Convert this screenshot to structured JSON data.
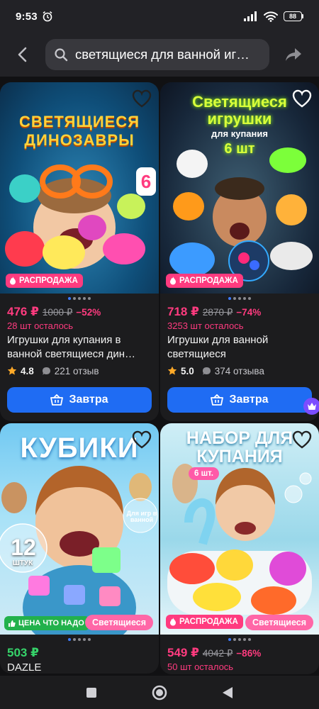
{
  "status_bar": {
    "time": "9:53",
    "battery": "88"
  },
  "header": {
    "search_query": "светящиеся для ванной иг…"
  },
  "products": [
    {
      "image_title_1": "СВЕТЯЩИЕСЯ",
      "image_title_2": "ДИНОЗАВРЫ",
      "image_count": "6",
      "badge": "РАСПРОДАЖА",
      "price": "476 ₽",
      "old_price": "1000 ₽",
      "discount": "−52%",
      "stock": "28 шт осталось",
      "title": "Игрушки для купания в ванной светящиеся дин…",
      "rating": "4.8",
      "reviews": "221 отзыв",
      "button": "Завтра"
    },
    {
      "image_title_1": "Светящиеся",
      "image_title_2": "игрушки",
      "image_title_3": "для купания",
      "image_count": "6 шт",
      "badge": "РАСПРОДАЖА",
      "price": "718 ₽",
      "old_price": "2870 ₽",
      "discount": "−74%",
      "stock": "3253 шт осталось",
      "title": "Игрушки для ванной светящиеся",
      "rating": "5.0",
      "reviews": "374 отзыва",
      "button": "Завтра"
    },
    {
      "image_title_1": "КУБИКИ",
      "image_count": "12",
      "image_count_unit": "ШТУК",
      "image_side_note": "Для игр в ванной",
      "badge": "ЦЕНА ЧТО НАДО",
      "tag": "Светящиеся",
      "price": "503 ₽",
      "brand": "DAZLE"
    },
    {
      "image_title_1": "НАБОР ДЛЯ",
      "image_title_2": "КУПАНИЯ",
      "image_count": "6 шт.",
      "badge": "РАСПРОДАЖА",
      "tag": "Светящиеся",
      "price": "549 ₽",
      "old_price": "4042 ₽",
      "discount": "−86%",
      "stock": "50 шт осталось"
    }
  ],
  "colors": {
    "accent": "#ff3b7f",
    "button": "#1f6cf3",
    "green": "#36d36a",
    "background": "#1c1c1e"
  }
}
